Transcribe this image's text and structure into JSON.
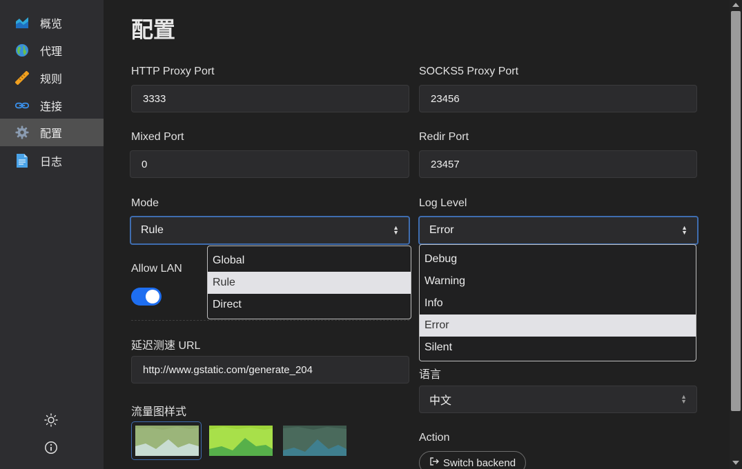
{
  "sidebar": {
    "items": [
      {
        "label": "概览",
        "icon": "chart-icon"
      },
      {
        "label": "代理",
        "icon": "globe-icon"
      },
      {
        "label": "规则",
        "icon": "ruler-icon"
      },
      {
        "label": "连接",
        "icon": "link-icon"
      },
      {
        "label": "配置",
        "icon": "gear-icon",
        "active": true
      },
      {
        "label": "日志",
        "icon": "document-icon"
      }
    ],
    "bottom": [
      "theme-sun-icon",
      "info-icon"
    ]
  },
  "page": {
    "title": "配置",
    "http_port": {
      "label": "HTTP Proxy Port",
      "value": "3333"
    },
    "socks_port": {
      "label": "SOCKS5 Proxy Port",
      "value": "23456"
    },
    "mixed_port": {
      "label": "Mixed Port",
      "value": "0"
    },
    "redir_port": {
      "label": "Redir Port",
      "value": "23457"
    },
    "mode": {
      "label": "Mode",
      "value": "Rule",
      "options": [
        "Global",
        "Rule",
        "Direct"
      ]
    },
    "log_level": {
      "label": "Log Level",
      "value": "Error",
      "options": [
        "Debug",
        "Warning",
        "Info",
        "Error",
        "Silent"
      ]
    },
    "allow_lan": {
      "label": "Allow LAN",
      "enabled": true
    },
    "latency_url": {
      "label": "延迟测速 URL",
      "value": "http://www.gstatic.com/generate_204"
    },
    "language": {
      "label": "语言",
      "value": "中文"
    },
    "traffic_chart_style": {
      "label": "流量图样式"
    },
    "action": {
      "label": "Action",
      "switch_backend": "Switch backend"
    }
  },
  "colors": {
    "accent": "#1e6ef0",
    "focus_border": "#3f6db0",
    "sidebar_bg": "#2d2d30",
    "page_bg": "#202020"
  }
}
